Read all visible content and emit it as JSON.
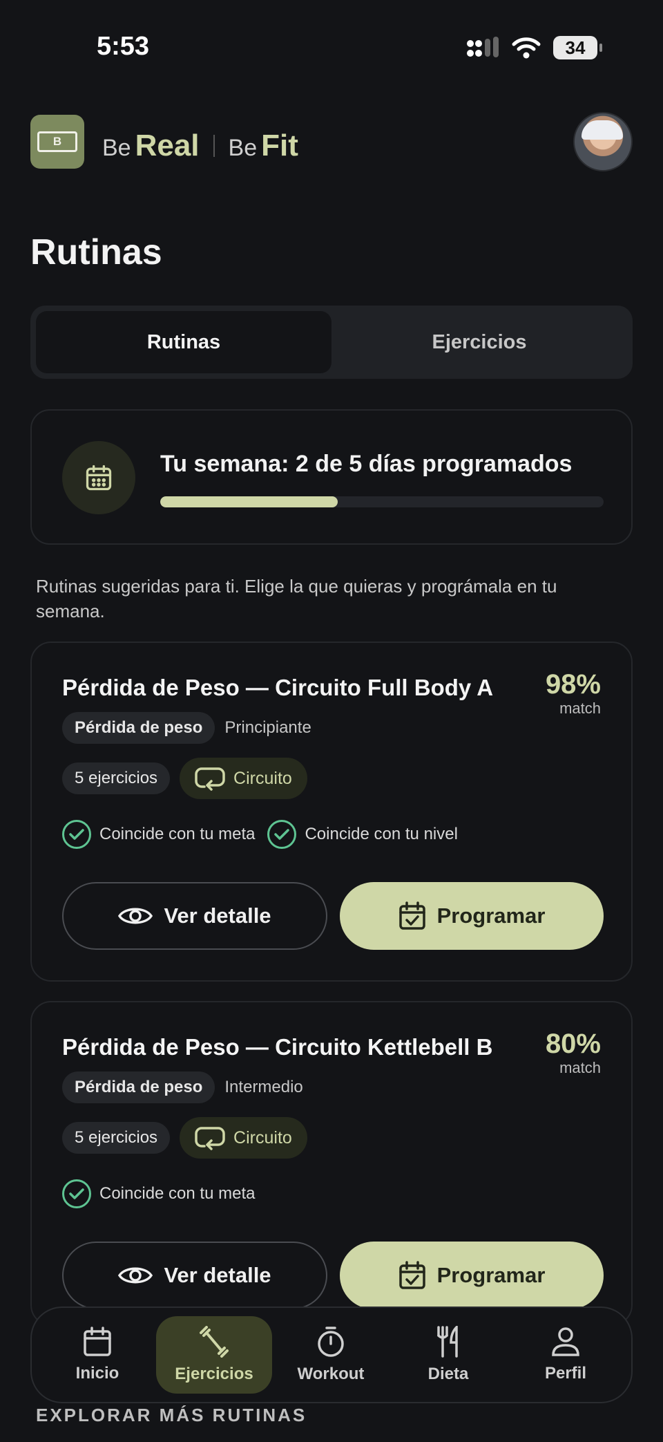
{
  "status_bar": {
    "time": "5:53",
    "battery": "34"
  },
  "header": {
    "be1": "Be",
    "word1": "Real",
    "be2": "Be",
    "word2": "Fit",
    "logo_text": "real fit"
  },
  "page_title": "Rutinas",
  "tabs": [
    {
      "label": "Rutinas",
      "active": true
    },
    {
      "label": "Ejercicios",
      "active": false
    }
  ],
  "week": {
    "title": "Tu semana: 2 de 5 días programados",
    "progress": 0.4
  },
  "intro": "Rutinas sugeridas para ti. Elige la que quieras y prográmala en tu semana.",
  "routines": [
    {
      "title": "Pérdida de Peso — Circuito Full Body A",
      "match": "98%",
      "match_label": "match",
      "goal_chip": "Pérdida de peso",
      "level": "Principiante",
      "exercises": "5 ejercicios",
      "type": "Circuito",
      "checks": [
        "Coincide con tu meta",
        "Coincide con tu nivel"
      ],
      "detail_btn": "Ver detalle",
      "schedule_btn": "Programar"
    },
    {
      "title": "Pérdida de Peso — Circuito Kettlebell B",
      "match": "80%",
      "match_label": "match",
      "goal_chip": "Pérdida de peso",
      "level": "Intermedio",
      "exercises": "5 ejercicios",
      "type": "Circuito",
      "checks": [
        "Coincide con tu meta"
      ],
      "detail_btn": "Ver detalle",
      "schedule_btn": "Programar"
    }
  ],
  "nav": [
    {
      "label": "Inicio",
      "icon": "calendar-icon"
    },
    {
      "label": "Ejercicios",
      "icon": "dumbbell-icon",
      "active": true
    },
    {
      "label": "Workout",
      "icon": "stopwatch-icon"
    },
    {
      "label": "Dieta",
      "icon": "utensils-icon"
    },
    {
      "label": "Perfil",
      "icon": "user-icon"
    }
  ],
  "explore": "EXPLORAR MÁS RUTINAS",
  "colors": {
    "accent": "#cfd7a7",
    "background": "#131417",
    "check": "#5ec492"
  }
}
